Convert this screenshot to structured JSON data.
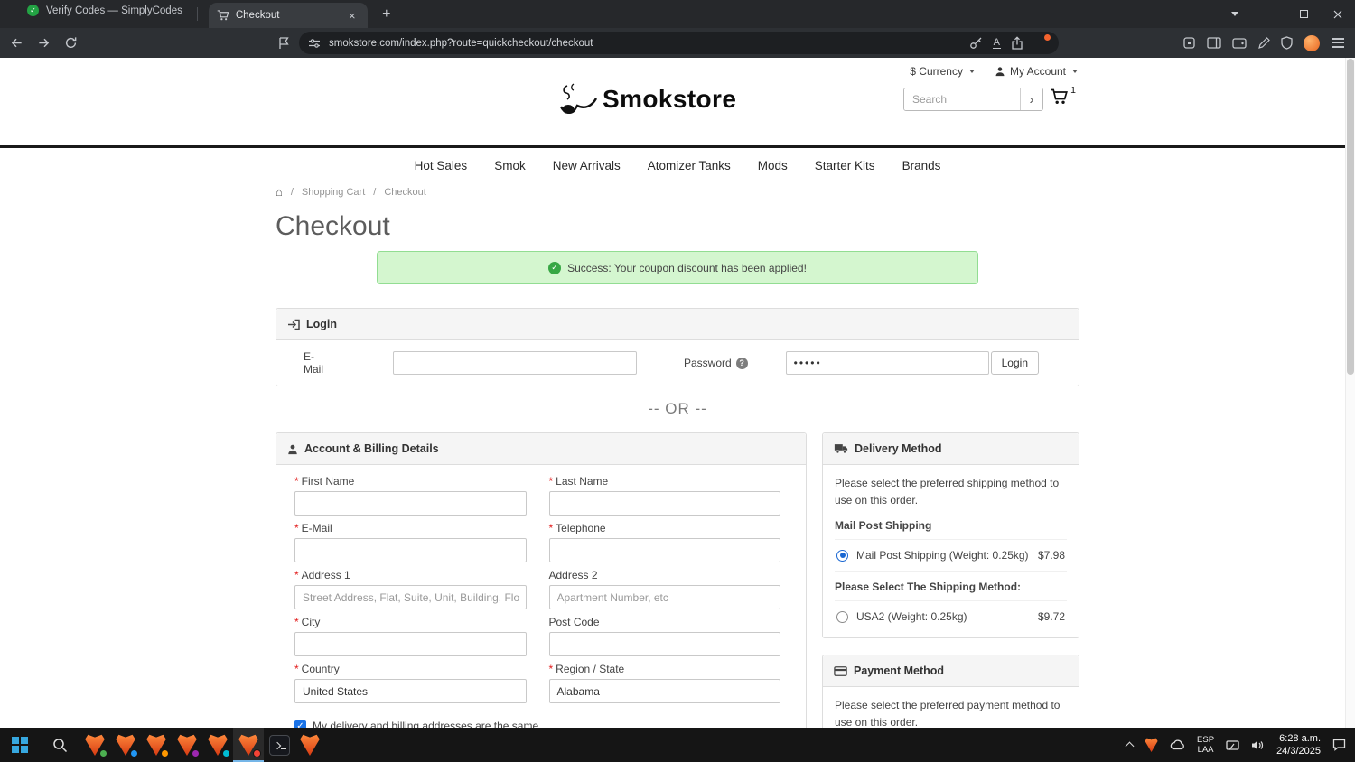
{
  "browser": {
    "inactive_tab_title": "Verify Codes — SimplyCodes",
    "active_tab_title": "Checkout",
    "url": "smokstore.com/index.php?route=quickcheckout/checkout"
  },
  "icons": {
    "home": "⌂",
    "separator": "/",
    "search_go": "›",
    "check": "✓",
    "question": "?",
    "close": "×",
    "plus": "+",
    "translate": "A",
    "required": "*"
  },
  "site_header": {
    "currency_label": "$ Currency",
    "account_label": "My Account",
    "logo_text": "Smokstore",
    "search_placeholder": "Search",
    "cart_count": "1"
  },
  "nav": {
    "items": [
      "Hot Sales",
      "Smok",
      "New Arrivals",
      "Atomizer Tanks",
      "Mods",
      "Starter Kits",
      "Brands"
    ]
  },
  "breadcrumb": {
    "shopping_cart": "Shopping Cart",
    "checkout": "Checkout"
  },
  "page": {
    "title": "Checkout",
    "success_message": "Success: Your coupon discount has been applied!",
    "or_text": "-- OR --"
  },
  "login": {
    "title": "Login",
    "email_label": "E-Mail",
    "password_label": "Password",
    "password_value": "•••••",
    "button": "Login"
  },
  "billing": {
    "title": "Account & Billing Details",
    "first_name": "First Name",
    "last_name": "Last Name",
    "email": "E-Mail",
    "telephone": "Telephone",
    "address1": "Address 1",
    "address1_placeholder": "Street Address, Flat, Suite, Unit, Building, Floor, etc",
    "address2": "Address 2",
    "address2_placeholder": "Apartment Number, etc",
    "city": "City",
    "post_code": "Post Code",
    "country": "Country",
    "country_value": "United States",
    "region": "Region / State",
    "region_value": "Alabama",
    "same_address": "My delivery and billing addresses are the same."
  },
  "delivery": {
    "title": "Delivery Method",
    "description": "Please select the preferred shipping method to use on this order.",
    "group1": "Mail Post Shipping",
    "option1_label": "Mail Post Shipping (Weight: 0.25kg)",
    "option1_price": "$7.98",
    "group2": "Please Select The Shipping Method:",
    "option2_label": "USA2 (Weight: 0.25kg)",
    "option2_price": "$9.72"
  },
  "payment": {
    "title": "Payment Method",
    "description": "Please select the preferred payment method to use on this order."
  },
  "taskbar": {
    "lang_top": "ESP",
    "lang_bottom": "LAA",
    "time": "6:28 a.m.",
    "date": "24/3/2025"
  }
}
